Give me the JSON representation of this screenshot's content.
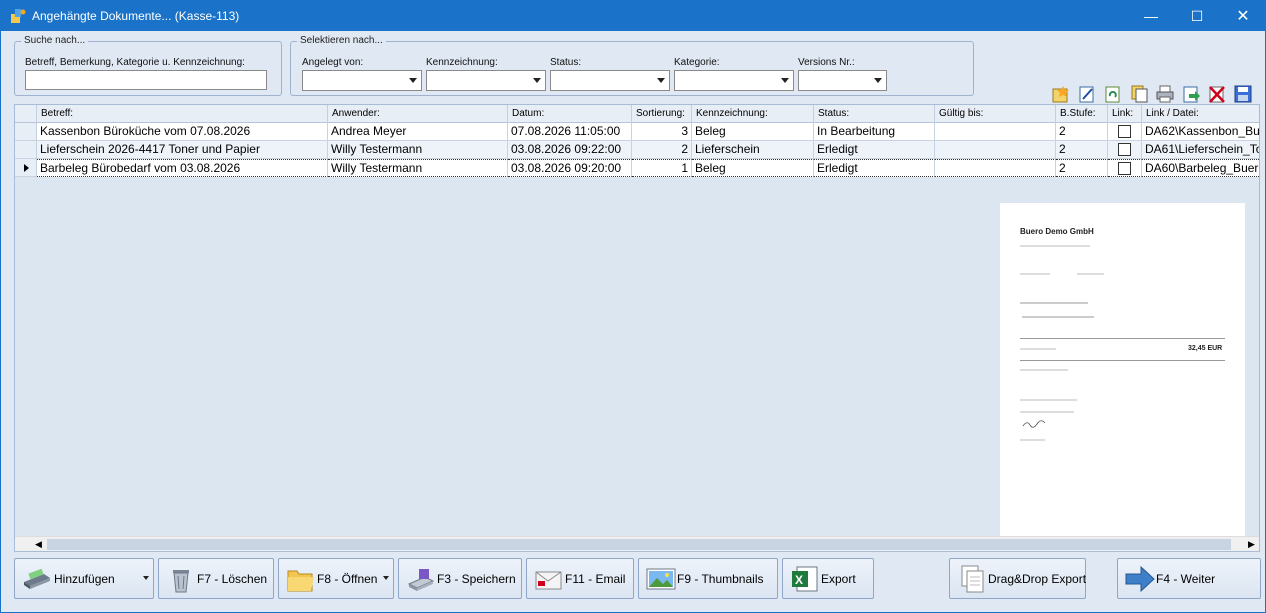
{
  "window": {
    "title": "Angehängte Dokumente... (Kasse-113)"
  },
  "search": {
    "legend": "Suche nach...",
    "label": "Betreff, Bemerkung, Kategorie u. Kennzeichnung:",
    "value": ""
  },
  "filter": {
    "legend": "Selektieren nach...",
    "fields": [
      {
        "label": "Angelegt von:",
        "value": ""
      },
      {
        "label": "Kennzeichnung:",
        "value": ""
      },
      {
        "label": "Status:",
        "value": ""
      },
      {
        "label": "Kategorie:",
        "value": ""
      },
      {
        "label": "Versions Nr.:",
        "value": ""
      }
    ]
  },
  "grid": {
    "columns": [
      "Betreff:",
      "Anwender:",
      "Datum:",
      "Sortierung:",
      "Kennzeichnung:",
      "Status:",
      "Gültig bis:",
      "B.Stufe:",
      "Link:",
      "Link / Datei:"
    ],
    "rows": [
      {
        "betreff": "Kassenbon Büroküche vom 07.08.2026",
        "anwender": "Andrea Meyer",
        "datum": "07.08.2026 11:05:00",
        "sortierung": "3",
        "kennzeichnung": "Beleg",
        "status": "In Bearbeitung",
        "gueltig": "",
        "bstufe": "2",
        "link": false,
        "datei": "DA62\\Kassenbon_Bu"
      },
      {
        "betreff": "Lieferschein 2026-4417 Toner und Papier",
        "anwender": "Willy Testermann",
        "datum": "03.08.2026 09:22:00",
        "sortierung": "2",
        "kennzeichnung": "Lieferschein",
        "status": "Erledigt",
        "gueltig": "",
        "bstufe": "2",
        "link": false,
        "datei": "DA61\\Lieferschein_To"
      },
      {
        "betreff": "Barbeleg Bürobedarf vom 03.08.2026",
        "anwender": "Willy Testermann",
        "datum": "03.08.2026 09:20:00",
        "sortierung": "1",
        "kennzeichnung": "Beleg",
        "status": "Erledigt",
        "gueltig": "",
        "bstufe": "2",
        "link": false,
        "datei": "DA60\\Barbeleg_Buer"
      }
    ]
  },
  "preview": {
    "company": "Buero Demo GmbH",
    "total": "32,45 EUR"
  },
  "buttons": {
    "add": "Hinzufügen",
    "delete": "F7 - Löschen",
    "open": "F8 - Öffnen",
    "save": "F3 - Speichern",
    "email": "F11 - Email",
    "thumbs": "F9 - Thumbnails",
    "export": "Export",
    "dragdrop": "Drag&Drop Export",
    "next": "F4 - Weiter"
  },
  "colors": {
    "titlebar": "#1a73c8",
    "background": "#dfe8f3"
  }
}
